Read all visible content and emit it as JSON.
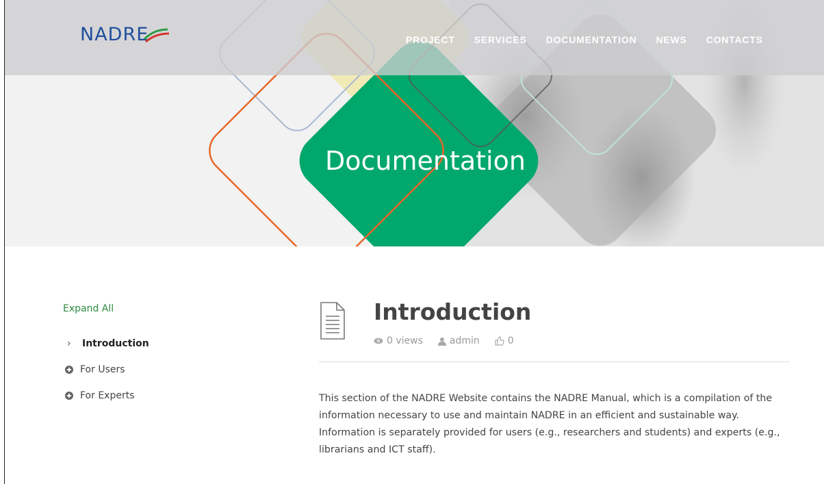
{
  "brand": {
    "logo_text": "NADRE",
    "primary": "#1e4f9c",
    "accent_green": "#00a86b",
    "accent_orange": "#e8662a"
  },
  "nav": {
    "items": [
      {
        "label": "PROJECT"
      },
      {
        "label": "SERVICES"
      },
      {
        "label": "DOCUMENTATION"
      },
      {
        "label": "NEWS"
      },
      {
        "label": "CONTACTS"
      }
    ]
  },
  "hero": {
    "title": "Documentation"
  },
  "sidebar": {
    "expand_all": "Expand All",
    "items": [
      {
        "label": "Introduction",
        "icon": "chevron-right-icon",
        "active": true
      },
      {
        "label": "For Users",
        "icon": "plus-circle-icon"
      },
      {
        "label": "For Experts",
        "icon": "plus-circle-icon"
      }
    ]
  },
  "article": {
    "title": "Introduction",
    "views": "0 views",
    "author": "admin",
    "likes": "0",
    "body": "This section of the NADRE Website contains the NADRE Manual, which is a compilation of the information necessary to use and maintain NADRE in an efficient and sustainable way. Information is separately provided for users (e.g., researchers and students) and experts (e.g., librarians and ICT staff)."
  }
}
